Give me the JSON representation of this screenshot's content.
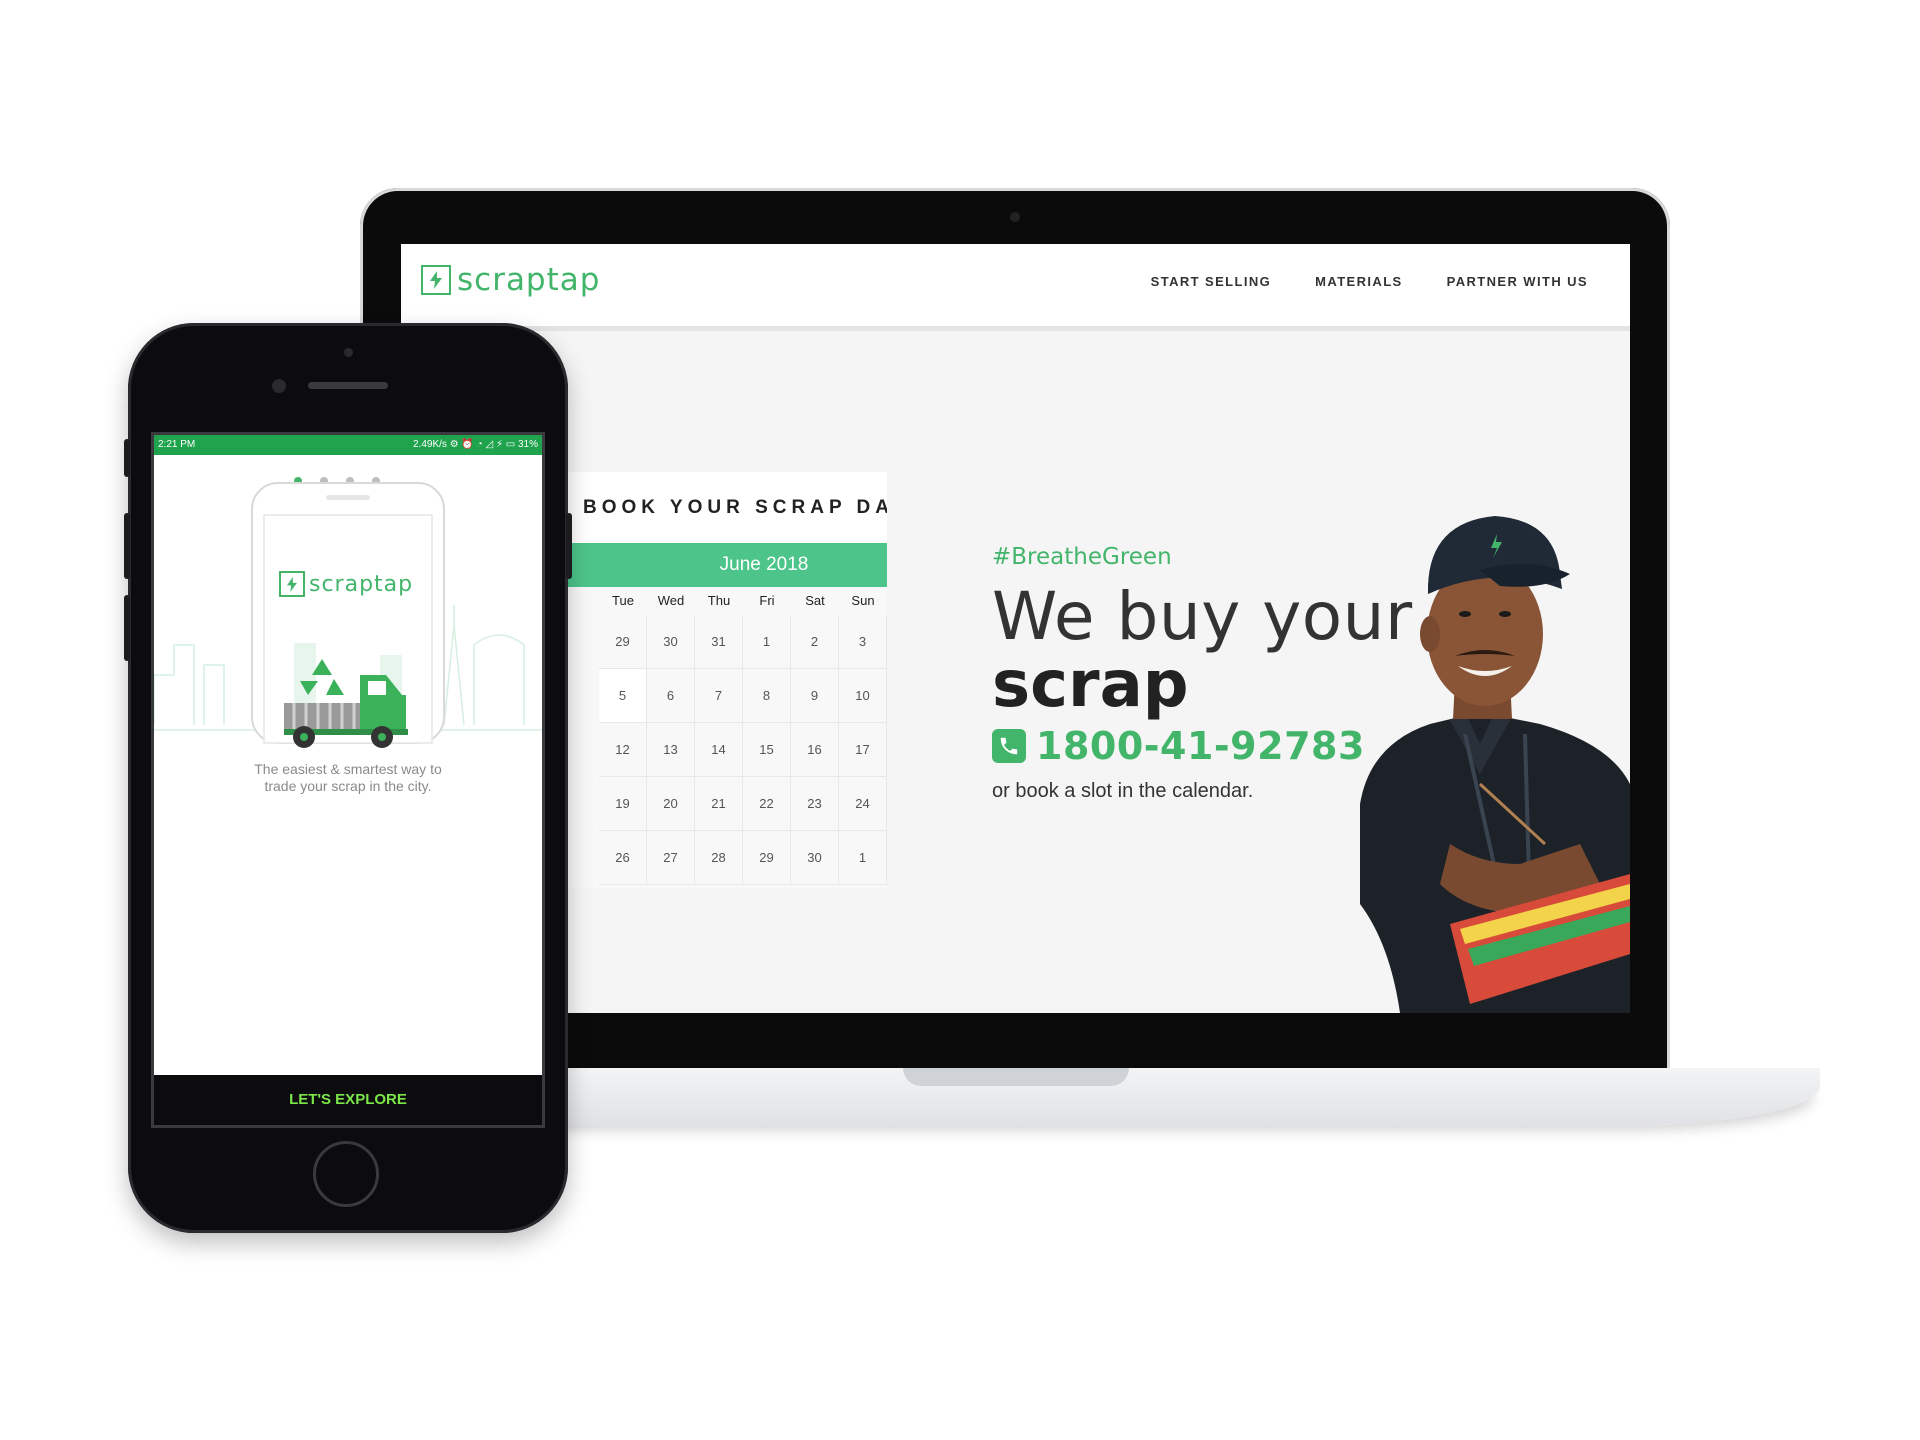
{
  "website": {
    "logo_text": "scraptap",
    "nav": [
      "START SELLING",
      "MATERIALS",
      "PARTNER WITH US"
    ],
    "calendar": {
      "heading": "BOOK YOUR SCRAP DAY",
      "month": "June 2018",
      "weekdays": [
        "Tue",
        "Wed",
        "Thu",
        "Fri",
        "Sat",
        "Sun"
      ],
      "weeks": [
        [
          "29",
          "30",
          "31",
          "1",
          "2",
          "3"
        ],
        [
          "5",
          "6",
          "7",
          "8",
          "9",
          "10"
        ],
        [
          "12",
          "13",
          "14",
          "15",
          "16",
          "17"
        ],
        [
          "19",
          "20",
          "21",
          "22",
          "23",
          "24"
        ],
        [
          "26",
          "27",
          "28",
          "29",
          "30",
          "1"
        ]
      ]
    },
    "hero": {
      "hashtag": "#BreatheGreen",
      "headline_line1": "We buy your",
      "headline_line2": "scrap",
      "phone": "1800-41-92783",
      "subtext": "or book a slot in the calendar."
    }
  },
  "app": {
    "status": {
      "time": "2:21 PM",
      "right": "2.49K/s ⚙ ⏰ ◔ ◿ ⚡ ▭ 31%"
    },
    "logo_text": "scraptap",
    "tagline_line1": "The easiest & smartest way to",
    "tagline_line2": "trade your scrap in the city.",
    "cta": "LET'S EXPLORE",
    "pager_active_index": 0,
    "pager_count": 4
  },
  "colors": {
    "brand_green": "#43b56a",
    "calendar_green": "#4cc48a",
    "status_green": "#1fa34d",
    "cta_text": "#7be64a"
  }
}
